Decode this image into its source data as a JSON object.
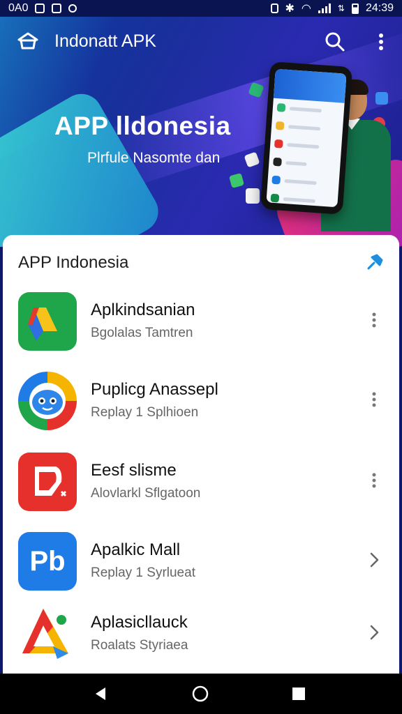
{
  "status_bar": {
    "left_text": "0A0",
    "time": "24:39"
  },
  "app_bar": {
    "title": "Indonatt APK"
  },
  "hero": {
    "title": "APP lldonesia",
    "subtitle": "Plrfule Nasomte dan"
  },
  "section": {
    "title": "APP Indonesia"
  },
  "apps": [
    {
      "name": "Aplkindsanian",
      "subtitle": "Bgolalas Tamtren",
      "action_icon": "more-vert-icon"
    },
    {
      "name": "Puplicg Anassepl",
      "subtitle": "Replay 1 Splhioen",
      "action_icon": "more-vert-icon"
    },
    {
      "name": "Eesf slisme",
      "subtitle": "Alovlarkl Sflgatoon",
      "action_icon": "more-vert-icon"
    },
    {
      "name": "Apalkic Mall",
      "subtitle": "Replay 1 Syrlueat",
      "icon_text": "Pb",
      "action_icon": "chevron-right-icon"
    },
    {
      "name": "Aplasicllauck",
      "subtitle": "Roalats Styriaea",
      "action_icon": "chevron-right-icon"
    }
  ],
  "colors": {
    "hero_blue": "#1a2f9c",
    "accent_cyan": "#3fe0d6",
    "pin_blue": "#1d8fe1",
    "icon_green": "#20a94a",
    "icon_red": "#e5302b",
    "icon_blue": "#1f7be6"
  }
}
